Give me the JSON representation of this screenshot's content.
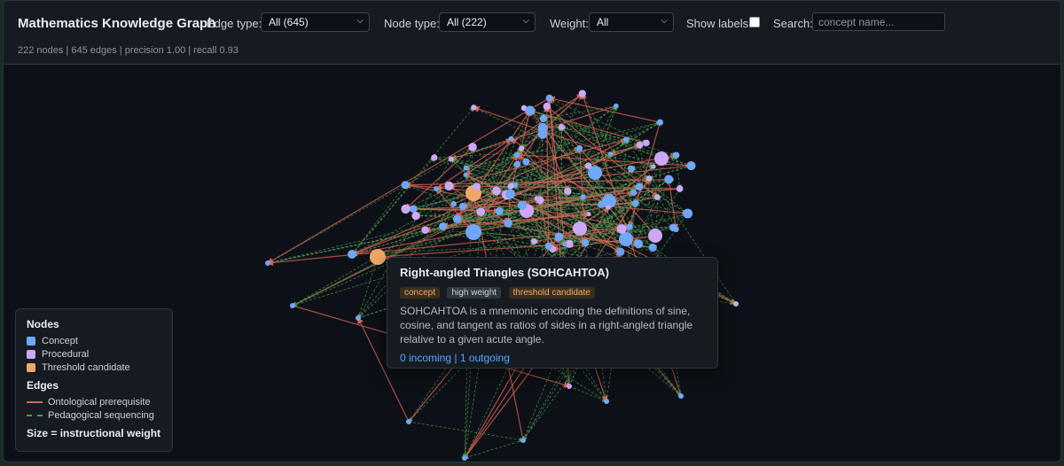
{
  "header": {
    "title": "Mathematics Knowledge Graph",
    "edge_type_label": "Edge type:",
    "edge_type_value": "All (645)",
    "node_type_label": "Node type:",
    "node_type_value": "All (222)",
    "weight_label": "Weight:",
    "weight_value": "All",
    "show_labels_label": "Show labels:",
    "show_labels_checked": false,
    "search_label": "Search:",
    "search_placeholder": "concept name...",
    "stats": "222 nodes | 645 edges | precision 1.00 | recall 0.93"
  },
  "colors": {
    "concept": "#6ea8f7",
    "procedural": "#cda8f7",
    "threshold": "#f0a868",
    "ontological": "#e06155",
    "pedagogical": "#4f9a4f"
  },
  "legend": {
    "nodes_title": "Nodes",
    "concept": "Concept",
    "procedural": "Procedural",
    "threshold": "Threshold candidate",
    "edges_title": "Edges",
    "ontological": "Ontological prerequisite",
    "pedagogical": "Pedagogical sequencing",
    "size_note": "Size = instructional weight"
  },
  "tooltip": {
    "title": "Right-angled Triangles (SOHCAHTOA)",
    "tags": [
      "concept",
      "high weight",
      "threshold candidate"
    ],
    "description": "SOHCAHTOA is a mnemonic encoding the definitions of sine, cosine, and tangent as ratios of sides in a right-angled triangle relative to a given acute angle.",
    "io": "0 incoming | 1 outgoing"
  }
}
